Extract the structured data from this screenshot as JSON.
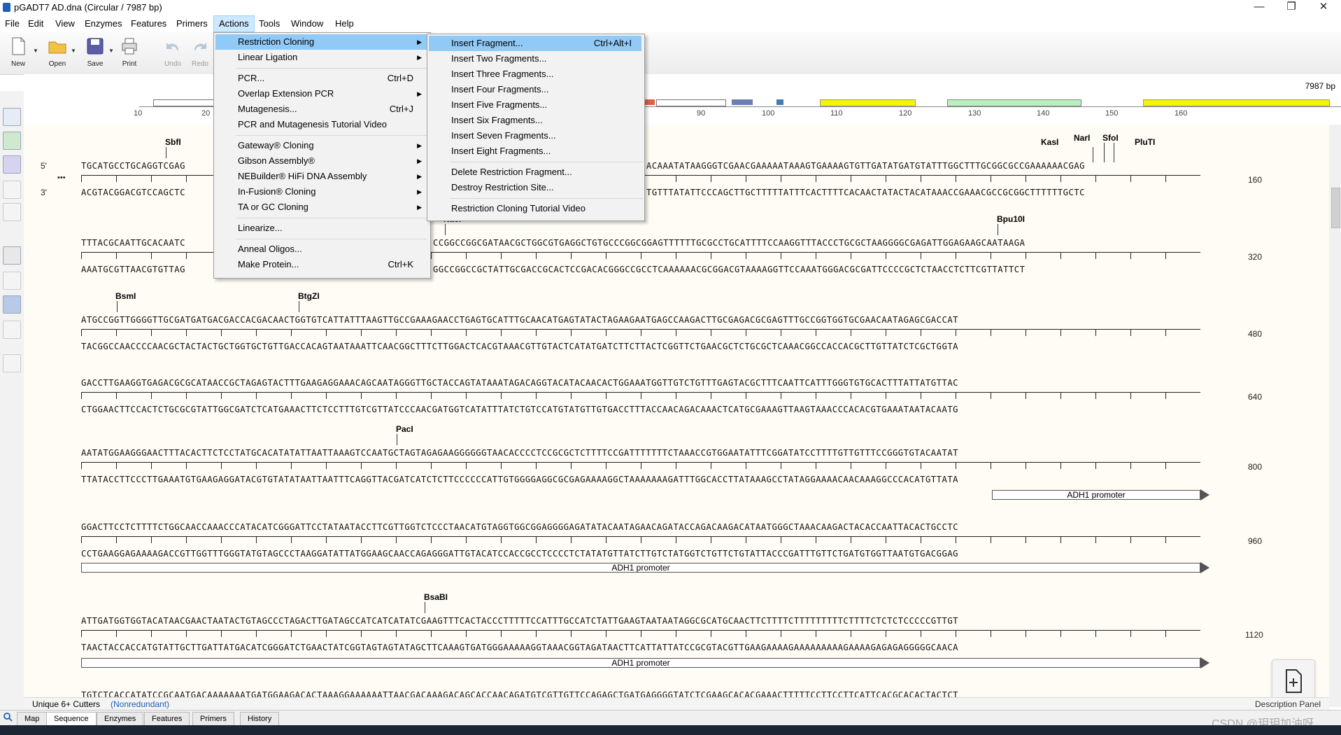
{
  "window": {
    "title": "pGADT7 AD.dna  (Circular / 7987 bp)",
    "minimize": "—",
    "maximize": "❐",
    "close": "✕"
  },
  "menubar": [
    "File",
    "Edit",
    "View",
    "Enzymes",
    "Features",
    "Primers",
    "Actions",
    "Tools",
    "Window",
    "Help"
  ],
  "toolbar": {
    "new": "New",
    "open": "Open",
    "save": "Save",
    "print": "Print",
    "undo": "Undo",
    "redo": "Redo"
  },
  "map": {
    "total_bp": "7987 bp",
    "ruler": [
      "10",
      "20",
      "90",
      "100",
      "110",
      "120",
      "130",
      "140",
      "150",
      "160"
    ]
  },
  "actions_menu": [
    {
      "label": "Restriction Cloning",
      "shortcut": "",
      "submenu": true
    },
    {
      "label": "Linear Ligation",
      "shortcut": "",
      "submenu": true
    },
    {
      "label": "PCR...",
      "shortcut": "Ctrl+D",
      "submenu": false
    },
    {
      "label": "Overlap Extension PCR",
      "shortcut": "",
      "submenu": true
    },
    {
      "label": "Mutagenesis...",
      "shortcut": "Ctrl+J",
      "submenu": false
    },
    {
      "label": "PCR and Mutagenesis Tutorial Video",
      "shortcut": "",
      "submenu": false
    },
    {
      "label": "Gateway® Cloning",
      "shortcut": "",
      "submenu": true
    },
    {
      "label": "Gibson Assembly®",
      "shortcut": "",
      "submenu": true
    },
    {
      "label": "NEBuilder® HiFi DNA Assembly",
      "shortcut": "",
      "submenu": true
    },
    {
      "label": "In-Fusion® Cloning",
      "shortcut": "",
      "submenu": true
    },
    {
      "label": "TA or GC Cloning",
      "shortcut": "",
      "submenu": true
    },
    {
      "label": "Linearize...",
      "shortcut": "",
      "submenu": false
    },
    {
      "label": "Anneal Oligos...",
      "shortcut": "",
      "submenu": false
    },
    {
      "label": "Make Protein...",
      "shortcut": "Ctrl+K",
      "submenu": false
    }
  ],
  "restriction_menu": [
    {
      "label": "Insert Fragment...",
      "shortcut": "Ctrl+Alt+I"
    },
    {
      "label": "Insert Two Fragments...",
      "shortcut": ""
    },
    {
      "label": "Insert Three Fragments...",
      "shortcut": ""
    },
    {
      "label": "Insert Four Fragments...",
      "shortcut": ""
    },
    {
      "label": "Insert Five Fragments...",
      "shortcut": ""
    },
    {
      "label": "Insert Six Fragments...",
      "shortcut": ""
    },
    {
      "label": "Insert Seven Fragments...",
      "shortcut": ""
    },
    {
      "label": "Insert Eight Fragments...",
      "shortcut": ""
    },
    {
      "label": "Delete Restriction Fragment...",
      "shortcut": ""
    },
    {
      "label": "Destroy Restriction Site...",
      "shortcut": ""
    },
    {
      "label": "Restriction Cloning Tutorial Video",
      "shortcut": ""
    }
  ],
  "sequence": {
    "strand_top": "5'",
    "strand_bottom": "3'",
    "ellipsis": "•••",
    "blocks": [
      {
        "top": "TGCATGCCTGCAGGTCGAG",
        "bottom": "ACGTACGGACGTCCAGCTC",
        "top_r": "ACAAATATAAGGGTCGAACGAAAAATAAAGTGAAAAGTGTTGATATGATGTATTTGGCTTTGCGGCGCCGAAAAAACGAG",
        "bottom_r": "TGTTTATATTCCCAGCTTGCTTTTTATTTCACTTTTCACAACTATACTACATAAACCGAAACGCCGCGGCTTTTTTGCTC",
        "num": "160"
      },
      {
        "top": "TTTACGCAATTGCACAATC",
        "bottom": "AAATGCGTTAACGTGTTAG",
        "top_r": "CCGGCCGGCGATAACGCTGGCGTGAGGCTGTGCCCGGCGGAGTTTTTTGCGCCTGCATTTTCCAAGGTTTACCCTGCGCTAAGGGGCGAGATTGGAGAAGCAATAAGA",
        "bottom_r": "GGCCGGCCGCTATTGCGACCGCACTCCGACACGGGCCGCCTCAAAAAACGCGGACGTAAAAGGTTCCAAATGGGACGCGATTCCCCGCTCTAACCTCTTCGTTATTCT",
        "num": "320"
      },
      {
        "top": "ATGCCGGTTGGGGTTGCGATGATGACGACCACGACAACTGGTGTCATTATTTAAGTTGCCGAAAGAACCTGAGTGCATTTGCAACATGAGTATACTAGAAGAATGAGCCAAGACTTGCGAGACGCGAGTTTGCCGGTGGTGCGAACAATAGAGCGACCAT",
        "bottom": "TACGGCCAACCCCAACGCTACTACTGCTGGTGCTGTTGACCACAGTAATAAATTCAACGGCTTTCTTGGACTCACGTAAACGTTGTACTCATATGATCTTCTTACTCGGTTCTGAACGCTCTGCGCTCAAACGGCCACCACGCTTGTTATCTCGCTGGTA",
        "num": "480"
      },
      {
        "top": "GACCTTGAAGGTGAGACGCGCATAACCGCTAGAGTACTTTGAAGAGGAAACAGCAATAGGGTTGCTACCAGTATAAATAGACAGGTACATACAACACTGGAAATGGTTGTCTGTTTGAGTACGCTTTCAATTCATTTGGGTGTGCACTTTATTATGTTAC",
        "bottom": "CTGGAACTTCCACTCTGCGCGTATTGGCGATCTCATGAAACTTCTCCTTTGTCGTTATCCCAACGATGGTCATATTTATCTGTCCATGTATGTTGTGACCTTTACCAACAGACAAACTCATGCGAAAGTTAAGTAAACCCACACGTGAAATAATACAATG",
        "num": "640"
      },
      {
        "top": "AATATGGAAGGGAACTTTACACTTCTCCTATGCACATATATTAATTAAAGTCCAATGCTAGTAGAGAAGGGGGGTAACACCCCTCCGCGCTCTTTTCCGATTTTTTTCTAAACCGTGGAATATTTCGGATATCCTTTTGTTGTTTCCGGGTGTACAATAT",
        "bottom": "TTATACCTTCCCTTGAAATGTGAAGAGGATACGTGTATATAATTAATTTCAGGTTACGATCATCTCTTCCCCCCATTGTGGGGAGGCGCGAGAAAAGGCTAAAAAAAGATTTGGCACCTTATAAAGCCTATAGGAAAACAACAAAGGCCCACATGTTATA",
        "num": "800"
      },
      {
        "top": "GGACTTCCTCTTTTCTGGCAACCAAACCCATACATCGGGATTCCTATAATACCTTCGTTGGTCTCCCTAACATGTAGGTGGCGGAGGGGAGATATACAATAGAACAGATACCAGACAAGACATAATGGGCTAAACAAGACTACACCAATTACACTGCCTC",
        "bottom": "CCTGAAGGAGAAAAGACCGTTGGTTTGGGTATGTAGCCCTAAGGATATTATGGAAGCAACCAGAGGGATTGTACATCCACCGCCTCCCCTCTATATGTTATCTTGTCTATGGTCTGTTCTGTATTACCCGATTTGTTCTGATGTGGTTAATGTGACGGAG",
        "num": "960"
      },
      {
        "top": "ATTGATGGTGGTACATAACGAACTAATACTGTAGCCCTAGACTTGATAGCCATCATCATATCGAAGTTTCACTACCCTTTTTCCATTTGCCATCTATTGAAGTAATAATAGGCGCATGCAACTTCTTTTCTTTTTTTTTCTTTTCTCTCTCCCCCGTTGT",
        "bottom": "TAACTACCACCATGTATTGCTTGATTATGACATCGGGATCTGAACTATCGGTAGTAGTATAGCTTCAAAGTGATGGGAAAAAGGTAAACGGTAGATAACTTCATTATTATCCGCGTACGTTGAAGAAAAGAAAAAAAAAGAAAAGAGAGAGGGGGCAACA",
        "num": "1120"
      },
      {
        "top": "TGTCTCACCATATCCGCAATGACAAAAAAATGATGGAAGACACTAAAGGAAAAAATTAACGACAAAGACAGCACCAACAGATGTCGTTGTTCCAGAGCTGATGAGGGGTATCTCGAAGCACACGAAACTTTTTCCTTCCTTCATTCACGCACACTACTCT"
      }
    ],
    "enzymes": [
      "SbfI",
      "KasI",
      "NarI",
      "SfoI",
      "PluTI",
      "NaeI",
      "Bpu10I",
      "BsmI",
      "BtgZI",
      "PacI",
      "BsaBI"
    ],
    "features": [
      "ADH1 promoter",
      "ADH1 promoter",
      "ADH1 promoter"
    ]
  },
  "status": {
    "cutters": "Unique 6+ Cutters",
    "mode": "(Nonredundant)",
    "desc": "Description Panel"
  },
  "tabs": [
    "Map",
    "Sequence",
    "Enzymes",
    "Features",
    "Primers",
    "History"
  ],
  "watermark": "CSDN @玥玥加油呀",
  "colors": {
    "menu_highlight": "#91c9f7",
    "feature_yellow": "#f5f500",
    "feature_green": "#b8f0c0",
    "seq_bg": "#fffcf5"
  }
}
